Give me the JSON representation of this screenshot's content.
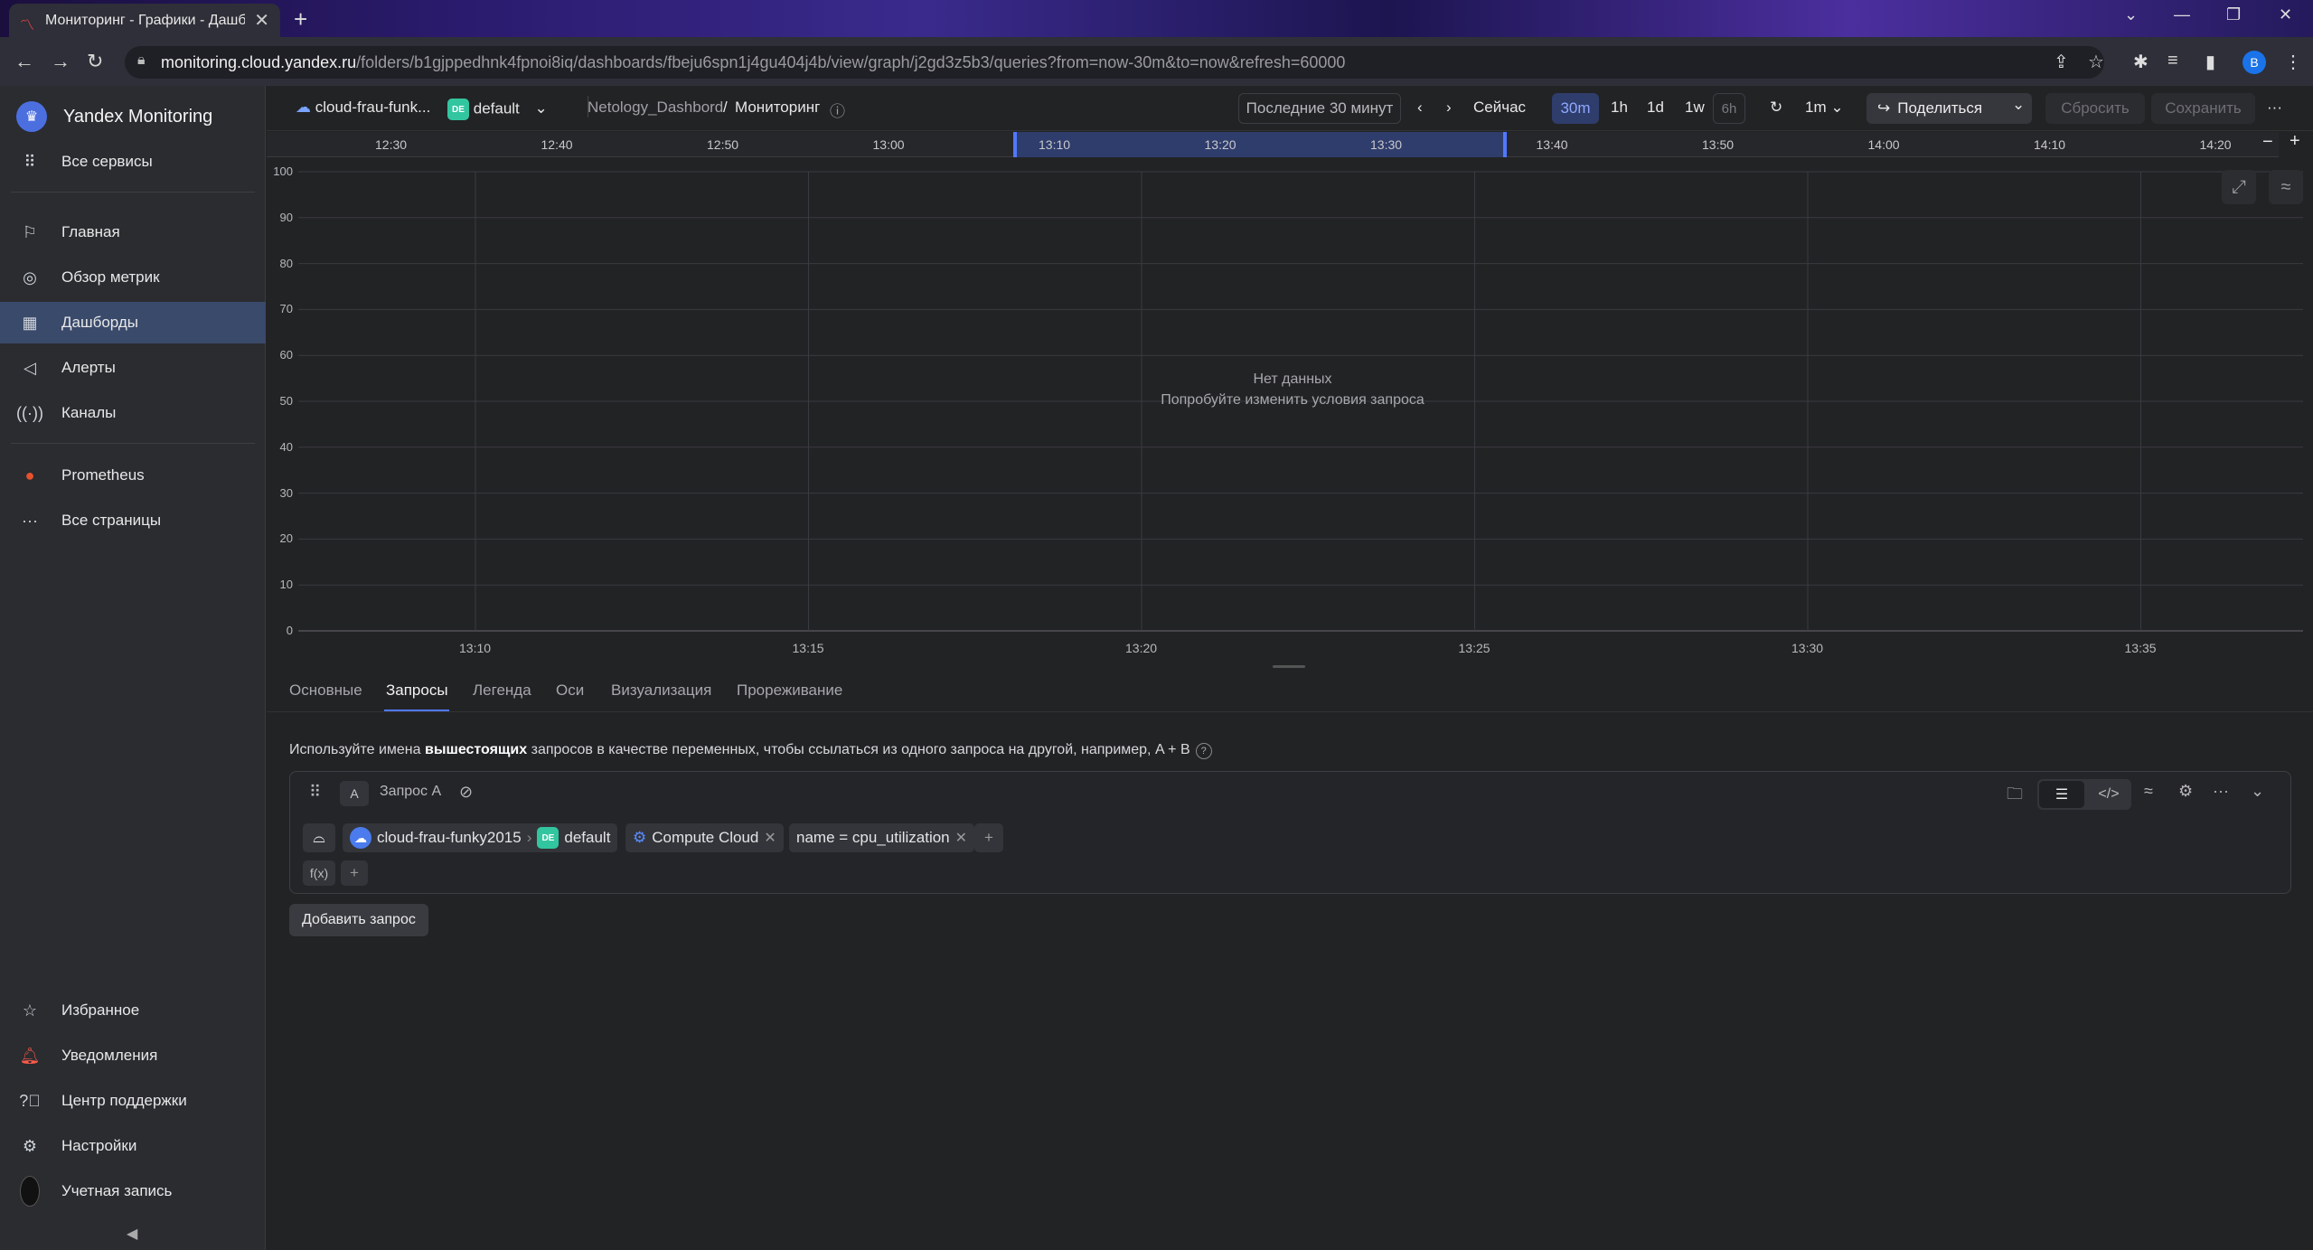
{
  "browser": {
    "tab_title": "Мониторинг - Графики - Дашбо",
    "url_host": "monitoring.cloud.yandex.ru",
    "url_path": "/folders/b1gjppedhnk4fpnoi8iq/dashboards/fbeju6spn1j4gu404j4b/view/graph/j2gd3z5b3/queries?from=now-30m&to=now&refresh=60000",
    "profile_initial": "B"
  },
  "sidebar": {
    "app_title": "Yandex Monitoring",
    "all_services": "Все сервисы",
    "items": [
      {
        "label": "Главная",
        "icon": "flag-icon"
      },
      {
        "label": "Обзор метрик",
        "icon": "compass-icon"
      },
      {
        "label": "Дашборды",
        "icon": "dashboard-icon"
      },
      {
        "label": "Алерты",
        "icon": "megaphone-icon"
      },
      {
        "label": "Каналы",
        "icon": "broadcast-icon"
      }
    ],
    "prometheus": "Prometheus",
    "all_pages": "Все страницы",
    "bottom": [
      {
        "label": "Избранное",
        "icon": "star-icon"
      },
      {
        "label": "Уведомления",
        "icon": "bell-icon"
      },
      {
        "label": "Центр поддержки",
        "icon": "help-icon"
      },
      {
        "label": "Настройки",
        "icon": "gear-icon"
      },
      {
        "label": "Учетная запись",
        "icon": "avatar"
      }
    ]
  },
  "toolbar": {
    "cloud": "cloud-frau-funk...",
    "folder_badge": "DE",
    "folder": "default",
    "crumb_dashboard": "Netology_Dashbord",
    "crumb_sep": "/",
    "crumb_page": "Мониторинг",
    "range_label": "Последние 30 минут",
    "now": "Сейчас",
    "ranges": [
      "30m",
      "1h",
      "1d",
      "1w",
      "6h"
    ],
    "refresh_interval": "1m",
    "share": "Поделиться",
    "reset": "Сбросить",
    "save": "Сохранить"
  },
  "timeline": {
    "labels": [
      "12:30",
      "12:40",
      "12:50",
      "13:00",
      "13:10",
      "13:20",
      "13:30",
      "13:40",
      "13:50",
      "14:00",
      "14:10",
      "14:20"
    ]
  },
  "chart_data": {
    "type": "line",
    "series": [],
    "y_ticks": [
      "100",
      "90",
      "80",
      "70",
      "60",
      "50",
      "40",
      "30",
      "20",
      "10",
      "0"
    ],
    "x_ticks": [
      "13:10",
      "13:15",
      "13:20",
      "13:25",
      "13:30",
      "13:35"
    ],
    "ylim": [
      0,
      100
    ],
    "grid": true,
    "empty_title": "Нет данных",
    "empty_hint": "Попробуйте изменить условия запроса"
  },
  "tabs": [
    "Основные",
    "Запросы",
    "Легенда",
    "Оси",
    "Визуализация",
    "Прореживание"
  ],
  "hint": {
    "before": "Используйте имена ",
    "bold": "вышестоящих",
    "after": " запросов в качестве переменных, чтобы ссылаться из одного запроса на другой, например, A  +  B",
    "q": "?"
  },
  "query": {
    "letter": "A",
    "name": "Запрос А",
    "cloud": "cloud-frau-funky2015",
    "folder_badge": "DE",
    "folder": "default",
    "service": "Compute Cloud",
    "label_filter": "name = cpu_utilization",
    "func": "f(x)"
  },
  "add_query": "Добавить запрос"
}
